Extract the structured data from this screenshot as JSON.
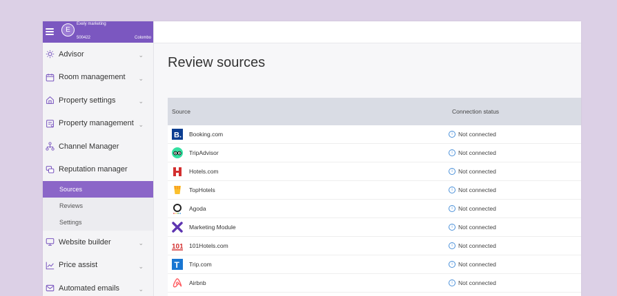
{
  "account": {
    "avatar_letter": "E",
    "name": "Exely marketing",
    "id": "500422",
    "city": "Colombo"
  },
  "sidebar": {
    "items": [
      {
        "label": "Advisor",
        "icon": "lightbulb-icon"
      },
      {
        "label": "Room management",
        "icon": "calendar-icon"
      },
      {
        "label": "Property settings",
        "icon": "home-icon"
      },
      {
        "label": "Property management",
        "icon": "clipboard-icon"
      },
      {
        "label": "Channel Manager",
        "icon": "hierarchy-icon"
      },
      {
        "label": "Reputation manager",
        "icon": "chat-icon"
      },
      {
        "label": "Website builder",
        "icon": "monitor-icon"
      },
      {
        "label": "Price assist",
        "icon": "chart-icon"
      },
      {
        "label": "Automated emails",
        "icon": "mail-icon"
      }
    ],
    "subitems": [
      {
        "label": "Sources",
        "active": true
      },
      {
        "label": "Reviews"
      },
      {
        "label": "Settings"
      }
    ]
  },
  "main": {
    "title": "Review sources",
    "columns": {
      "source": "Source",
      "status": "Connection status"
    },
    "rows": [
      {
        "source": "Booking.com",
        "status": "Not connected"
      },
      {
        "source": "TripAdvisor",
        "status": "Not connected"
      },
      {
        "source": "Hotels.com",
        "status": "Not connected"
      },
      {
        "source": "TopHotels",
        "status": "Not connected"
      },
      {
        "source": "Agoda",
        "status": "Not connected"
      },
      {
        "source": "Marketing Module",
        "status": "Not connected"
      },
      {
        "source": "101Hotels.com",
        "status": "Not connected"
      },
      {
        "source": "Trip.com",
        "status": "Not connected"
      },
      {
        "source": "Airbnb",
        "status": "Not connected"
      }
    ]
  },
  "colors": {
    "accent": "#7b57c0",
    "background": "#dcd0e6",
    "table_header": "#d9dce4"
  }
}
